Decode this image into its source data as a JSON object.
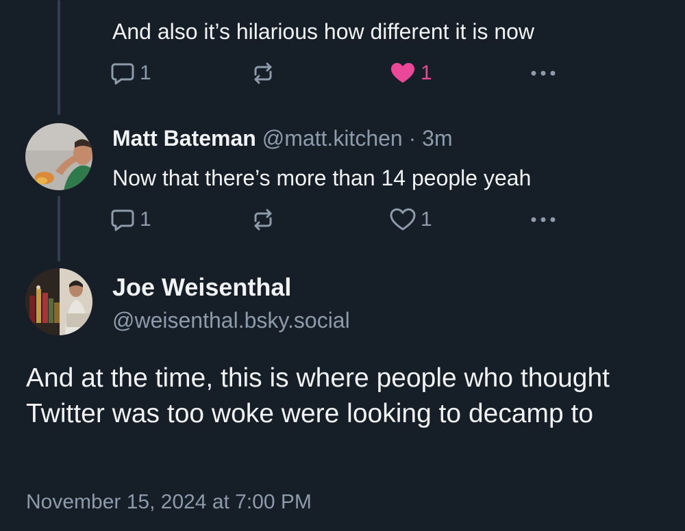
{
  "previous_post": {
    "text": "And also it’s hilarious how different it is now",
    "actions": {
      "reply_count": "1",
      "like_count": "1",
      "liked": true
    }
  },
  "reply_post": {
    "author_name": "Matt Bateman",
    "author_handle": "@matt.kitchen",
    "separator": " · ",
    "time": "3m",
    "text": "Now that there’s more than 14 people yeah",
    "actions": {
      "reply_count": "1",
      "like_count": "1",
      "liked": false
    }
  },
  "main_post": {
    "author_name": "Joe Weisenthal",
    "author_handle": "@weisenthal.bsky.social",
    "text": "And at the time, this is where people who thought Twitter was too woke were looking to decamp to",
    "timestamp": "November 15, 2024 at 7:00 PM"
  },
  "colors": {
    "background": "#161e27",
    "text_primary": "#f1f3f5",
    "text_secondary": "#8d9bab",
    "like_active": "#ec4899",
    "thread_line": "#2e4052"
  },
  "icons": {
    "reply": "speech-bubble-icon",
    "repost": "repost-arrows-icon",
    "like": "heart-icon",
    "more": "horizontal-ellipsis-icon"
  }
}
